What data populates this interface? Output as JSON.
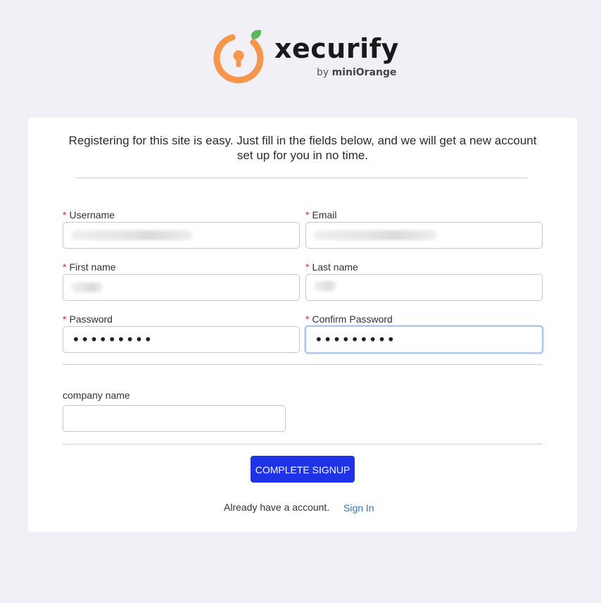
{
  "brand": {
    "name": "xecurify",
    "by_prefix": "by ",
    "by_company": "miniOrange",
    "accent": "#f7964b",
    "leaf": "#5cb85c"
  },
  "intro_text": "Registering for this site is easy. Just fill in the fields below, and we will get a new account set up for you in no time.",
  "form": {
    "required_marker": "*",
    "username": {
      "label": "Username",
      "value": ""
    },
    "email": {
      "label": "Email",
      "value": ""
    },
    "first_name": {
      "label": "First name",
      "value": ""
    },
    "last_name": {
      "label": "Last name",
      "value": ""
    },
    "password": {
      "label": "Password",
      "value": "•••••••••"
    },
    "confirm_password": {
      "label": "Confirm Password",
      "value": "•••••••••"
    },
    "company_name": {
      "label": "company name",
      "value": ""
    }
  },
  "submit_label": "COMPLETE SIGNUP",
  "footer": {
    "prompt": "Already have a account.",
    "signin_label": "Sign In"
  },
  "colors": {
    "button": "#1f33e6",
    "link": "#2e79c2",
    "required": "#d93025"
  }
}
